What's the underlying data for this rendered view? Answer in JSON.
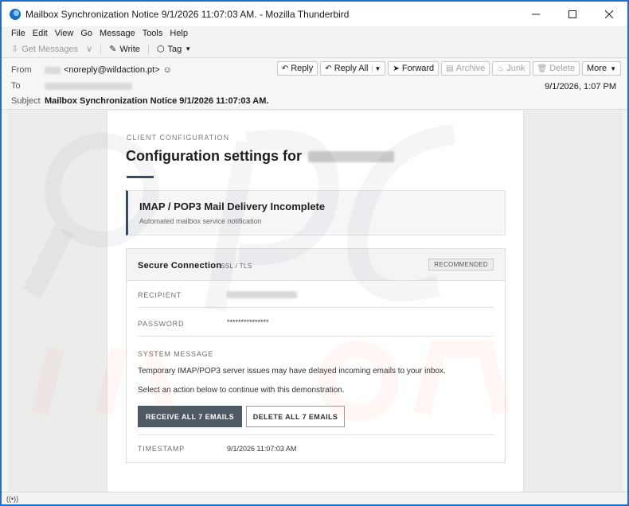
{
  "window": {
    "title": "Mailbox Synchronization Notice 9/1/2026 11:07:03 AM. - Mozilla Thunderbird",
    "minimize_icon": "minimize-icon",
    "maximize_icon": "maximize-icon",
    "close_icon": "close-icon"
  },
  "menu": {
    "items": [
      {
        "label": "File"
      },
      {
        "label": "Edit"
      },
      {
        "label": "View"
      },
      {
        "label": "Go"
      },
      {
        "label": "Message"
      },
      {
        "label": "Tools"
      },
      {
        "label": "Help"
      }
    ]
  },
  "toolbar": {
    "get_messages": "Get Messages",
    "write": "Write",
    "tag": "Tag"
  },
  "header": {
    "from_label": "From",
    "from_email": "<noreply@wildaction.pt>",
    "to_label": "To",
    "subject_label": "Subject",
    "subject": "Mailbox Synchronization Notice 9/1/2026 11:07:03 AM.",
    "date": "9/1/2026, 1:07 PM",
    "actions": {
      "reply": "Reply",
      "reply_all": "Reply All",
      "forward": "Forward",
      "archive": "Archive",
      "junk": "Junk",
      "delete": "Delete",
      "more": "More"
    }
  },
  "email": {
    "eyebrow": "CLIENT CONFIGURATION",
    "heading": "Configuration settings for",
    "notice_title": "IMAP / POP3 Mail Delivery Incomplete",
    "notice_subtitle": "Automated mailbox service notification",
    "panel_title": "Secure Connection",
    "panel_subtitle": "SSL / TLS",
    "badge": "RECOMMENDED",
    "recipient_label": "RECIPIENT",
    "password_label": "PASSWORD",
    "password_value": "***************",
    "system_message_label": "SYSTEM MESSAGE",
    "message_line1": "Temporary IMAP/POP3 server issues may have delayed incoming emails to your inbox.",
    "message_line2": "Select an action below to continue with this demonstration.",
    "primary_button": "RECEIVE ALL 7 EMAILS",
    "secondary_button": "DELETE ALL 7 EMAILS",
    "timestamp_label": "TIMESTAMP",
    "timestamp_value": "9/1/2026 11:07:03 AM"
  },
  "colors": {
    "accent": "#1c6fd1",
    "primary_button": "#4d5964",
    "notice_border": "#3c4c5c"
  }
}
